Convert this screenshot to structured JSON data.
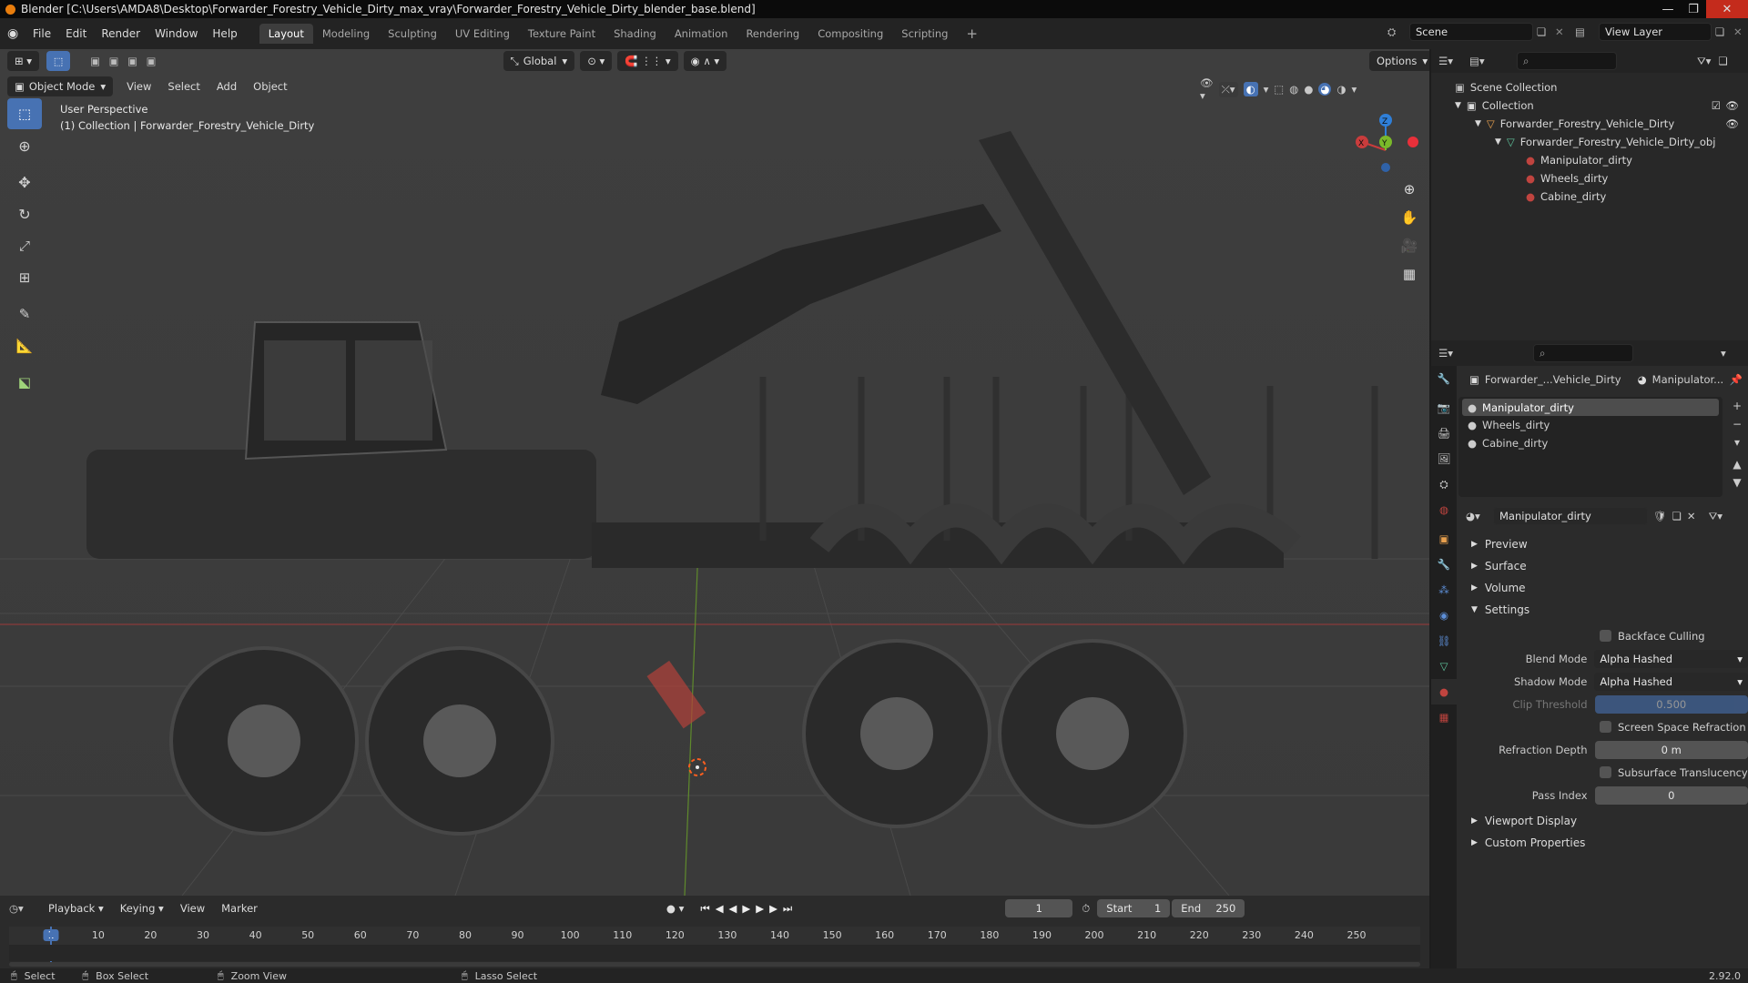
{
  "window": {
    "title": "Blender [C:\\Users\\AMDA8\\Desktop\\Forwarder_Forestry_Vehicle_Dirty_max_vray\\Forwarder_Forestry_Vehicle_Dirty_blender_base.blend]",
    "min": "—",
    "max": "❐",
    "close": "✕"
  },
  "menu": [
    "File",
    "Edit",
    "Render",
    "Window",
    "Help"
  ],
  "workspaces": [
    "Layout",
    "Modeling",
    "Sculpting",
    "UV Editing",
    "Texture Paint",
    "Shading",
    "Animation",
    "Rendering",
    "Compositing",
    "Scripting"
  ],
  "active_workspace": "Layout",
  "add_workspace": "+",
  "scene": {
    "name": "Scene",
    "view_layer": "View Layer"
  },
  "viewport": {
    "transform_orientation": "Global",
    "options": "Options",
    "mode": "Object Mode",
    "header_menu": [
      "View",
      "Select",
      "Add",
      "Object"
    ],
    "info_line1": "User Perspective",
    "info_line2": "(1) Collection | Forwarder_Forestry_Vehicle_Dirty",
    "gizmo": {
      "x": "X",
      "y": "Y",
      "z": "Z"
    }
  },
  "outliner": {
    "scene_collection": "Scene Collection",
    "collection": "Collection",
    "object": "Forwarder_Forestry_Vehicle_Dirty",
    "mesh": "Forwarder_Forestry_Vehicle_Dirty_obj",
    "materials": [
      "Manipulator_dirty",
      "Wheels_dirty",
      "Cabine_dirty"
    ]
  },
  "properties": {
    "breadcrumb_object": "Forwarder_...Vehicle_Dirty",
    "breadcrumb_material": "Manipulator...",
    "slots": [
      "Manipulator_dirty",
      "Wheels_dirty",
      "Cabine_dirty"
    ],
    "material_name": "Manipulator_dirty",
    "sections": {
      "preview": "Preview",
      "surface": "Surface",
      "volume": "Volume",
      "settings": "Settings",
      "viewport_display": "Viewport Display",
      "custom_properties": "Custom Properties"
    },
    "settings": {
      "backface_culling": "Backface Culling",
      "blend_mode_label": "Blend Mode",
      "blend_mode": "Alpha Hashed",
      "shadow_mode_label": "Shadow Mode",
      "shadow_mode": "Alpha Hashed",
      "clip_threshold_label": "Clip Threshold",
      "clip_threshold": "0.500",
      "ssr": "Screen Space Refraction",
      "refraction_depth_label": "Refraction Depth",
      "refraction_depth": "0 m",
      "subsurface": "Subsurface Translucency",
      "pass_index_label": "Pass Index",
      "pass_index": "0"
    }
  },
  "timeline": {
    "menu": [
      "Playback",
      "Keying",
      "View",
      "Marker"
    ],
    "current_frame": "1",
    "start_label": "Start",
    "start": "1",
    "end_label": "End",
    "end": "250",
    "ticks": [
      "1",
      "10",
      "20",
      "30",
      "40",
      "50",
      "60",
      "70",
      "80",
      "90",
      "100",
      "110",
      "120",
      "130",
      "140",
      "150",
      "160",
      "170",
      "180",
      "190",
      "200",
      "210",
      "220",
      "230",
      "240",
      "250"
    ]
  },
  "status": {
    "select": "Select",
    "box_select": "Box Select",
    "zoom_view": "Zoom View",
    "lasso_select": "Lasso Select",
    "version": "2.92.0"
  },
  "colors": {
    "accent": "#4772b3",
    "x_axis": "#c93c3c",
    "y_axis": "#7ab92a",
    "z_axis": "#2f7fd8",
    "material": "#c0443f"
  }
}
